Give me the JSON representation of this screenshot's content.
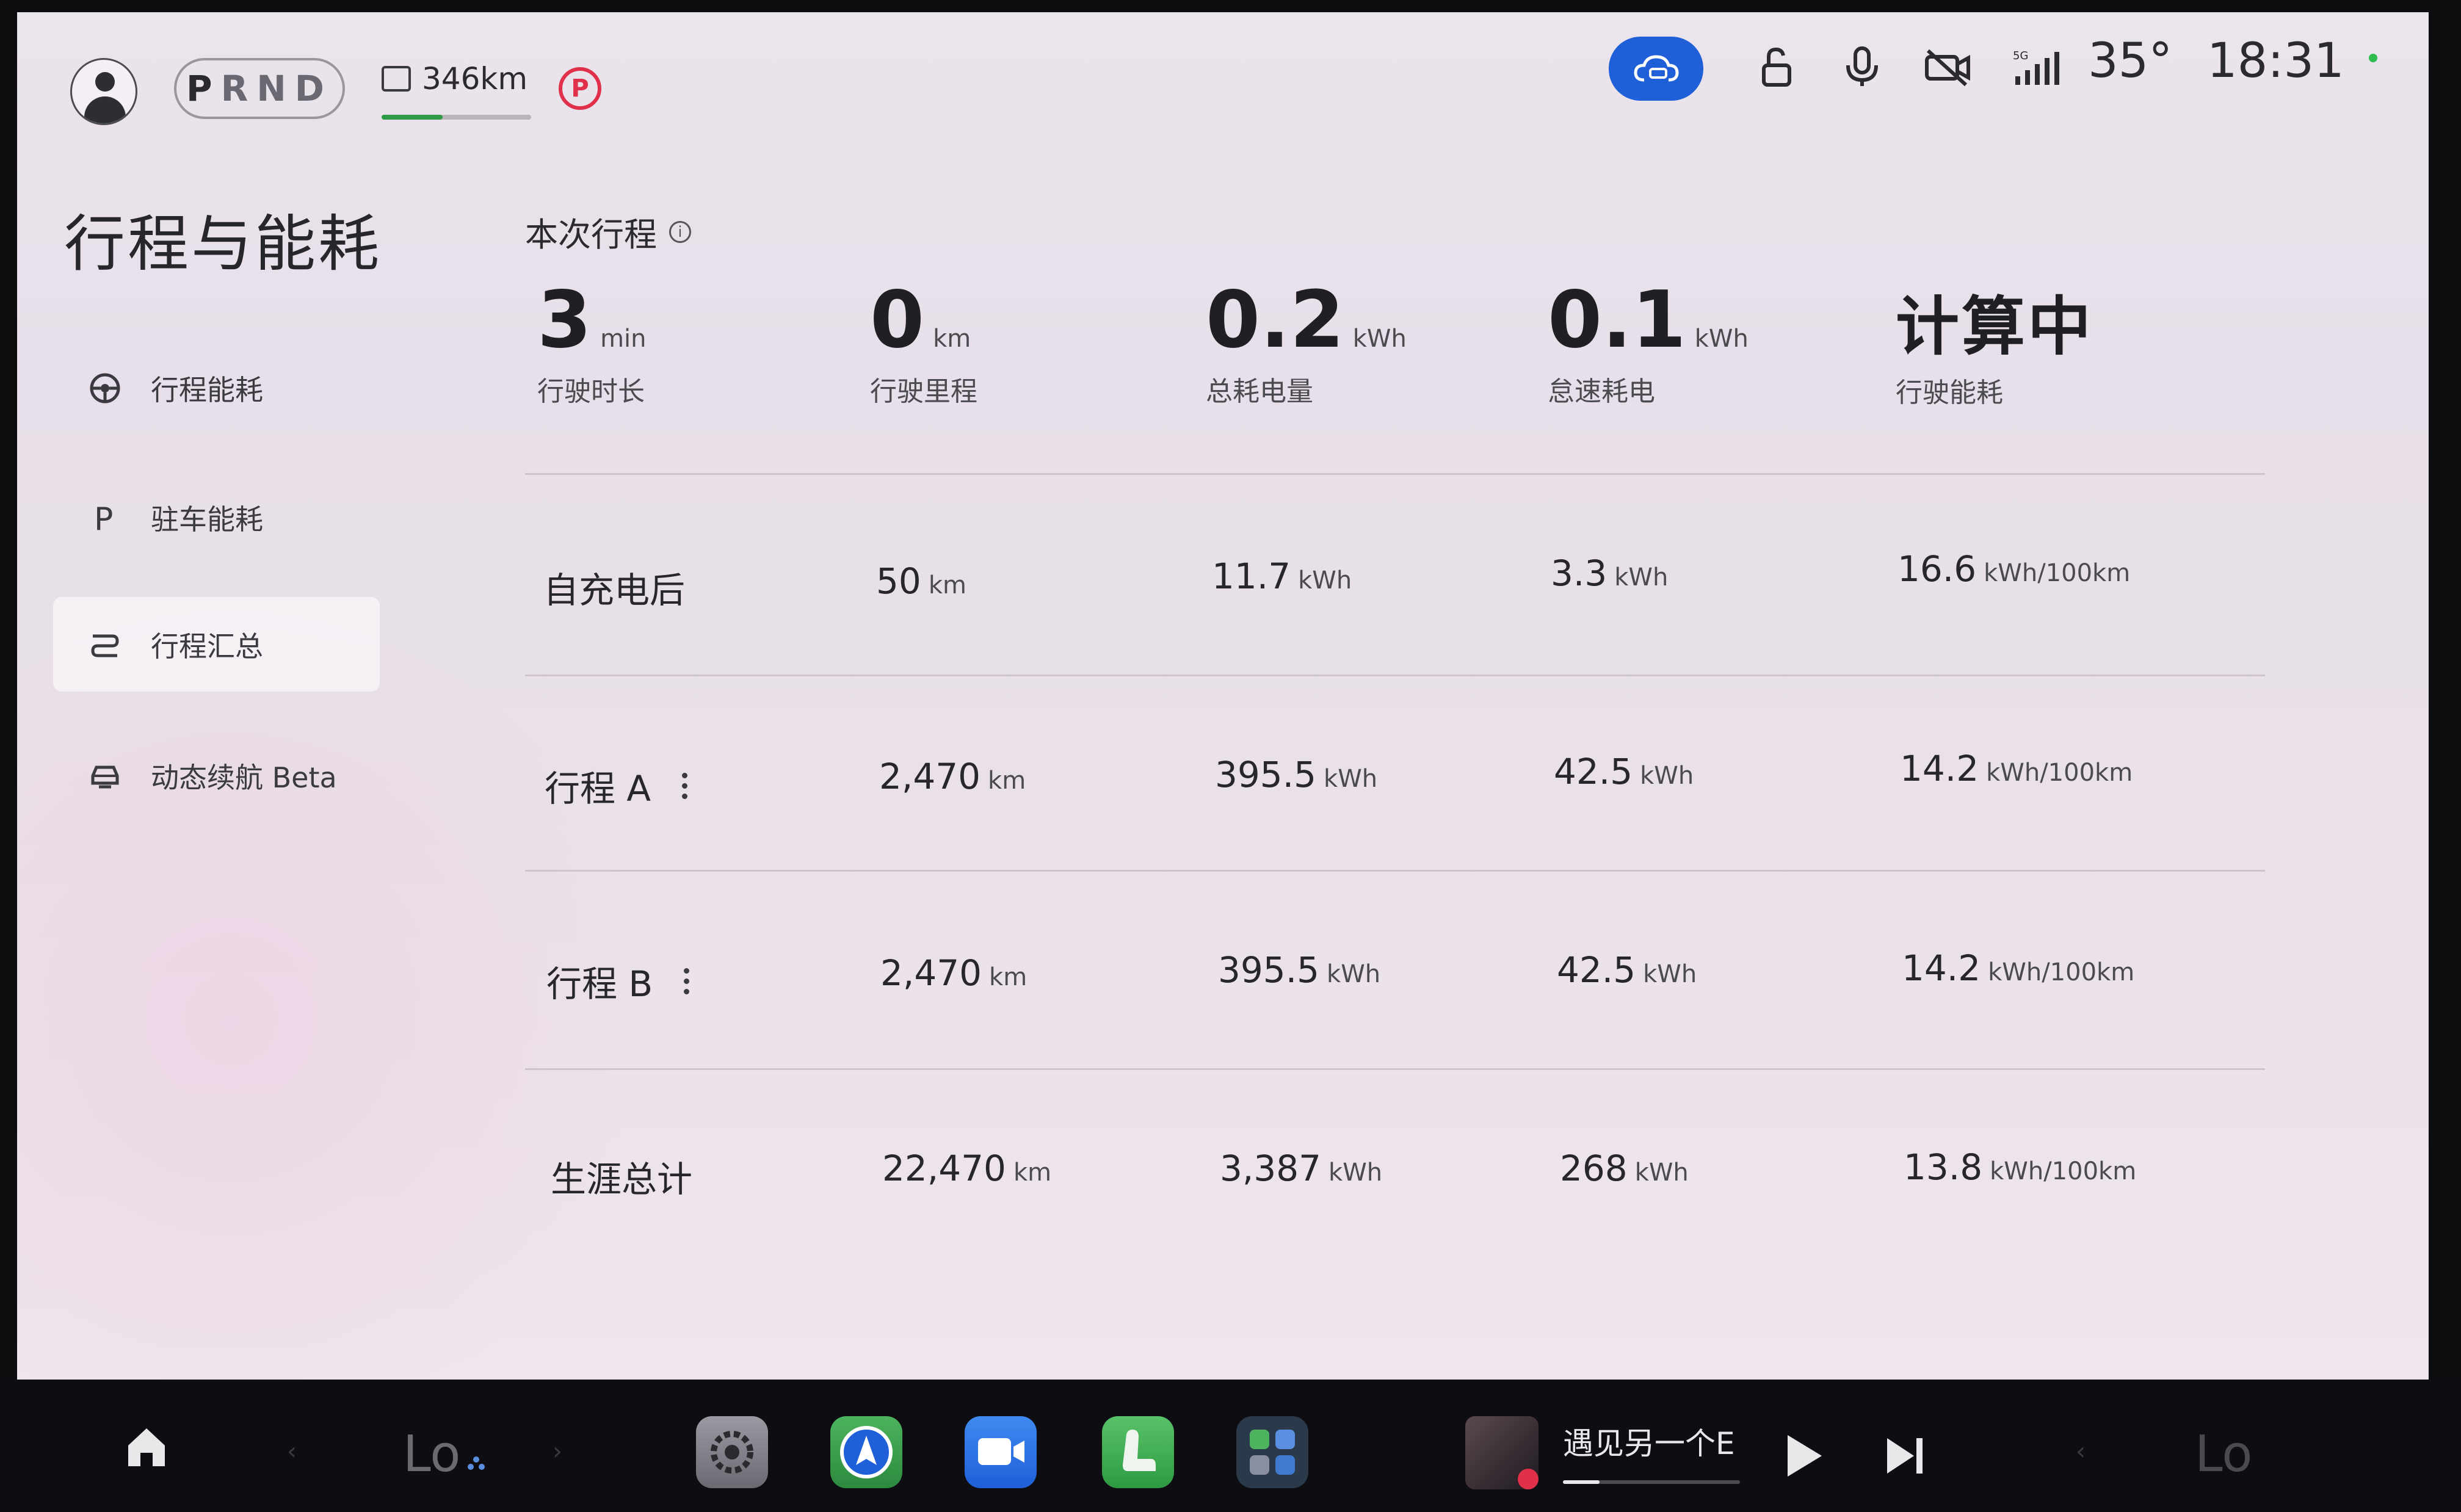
{
  "status_bar": {
    "gears": [
      "P",
      "R",
      "N",
      "D"
    ],
    "range": "346km",
    "park_symbol": "P",
    "temperature": "35°",
    "time": "18:31",
    "network": "5G"
  },
  "sidebar": {
    "title": "行程与能耗",
    "items": [
      {
        "label": "行程能耗",
        "icon": "steering-wheel-icon"
      },
      {
        "label": "驻车能耗",
        "icon": "parking-letter-icon"
      },
      {
        "label": "行程汇总",
        "icon": "route-icon"
      },
      {
        "label": "动态续航 Beta",
        "icon": "car-range-icon"
      }
    ]
  },
  "current_trip": {
    "title": "本次行程",
    "stats": [
      {
        "value": "3",
        "unit": "min",
        "label": "行驶时长"
      },
      {
        "value": "0",
        "unit": "km",
        "label": "行驶里程"
      },
      {
        "value": "0.2",
        "unit": "kWh",
        "label": "总耗电量"
      },
      {
        "value": "0.1",
        "unit": "kWh",
        "label": "怠速耗电"
      },
      {
        "value": "计算中",
        "unit": "",
        "label": "行驶能耗"
      }
    ]
  },
  "summary_rows": [
    {
      "label": "自充电后",
      "distance": "50",
      "distance_unit": "km",
      "total": "11.7",
      "total_unit": "kWh",
      "idle": "3.3",
      "idle_unit": "kWh",
      "consumption": "16.6",
      "consumption_unit": "kWh/100km",
      "menu": false
    },
    {
      "label": "行程 A",
      "distance": "2,470",
      "distance_unit": "km",
      "total": "395.5",
      "total_unit": "kWh",
      "idle": "42.5",
      "idle_unit": "kWh",
      "consumption": "14.2",
      "consumption_unit": "kWh/100km",
      "menu": true
    },
    {
      "label": "行程 B",
      "distance": "2,470",
      "distance_unit": "km",
      "total": "395.5",
      "total_unit": "kWh",
      "idle": "42.5",
      "idle_unit": "kWh",
      "consumption": "14.2",
      "consumption_unit": "kWh/100km",
      "menu": true
    },
    {
      "label": "生涯总计",
      "distance": "22,470",
      "distance_unit": "km",
      "total": "3,387",
      "total_unit": "kWh",
      "idle": "268",
      "idle_unit": "kWh",
      "consumption": "13.8",
      "consumption_unit": "kWh/100km",
      "menu": false
    }
  ],
  "dock": {
    "left_climate": "Lo",
    "right_climate": "Lo",
    "media_title": "遇见另一个E",
    "media_progress": 0.2
  },
  "colors": {
    "accent_blue": "#1f5fd8",
    "park_red": "#e0304a",
    "range_green": "#2e9b4a"
  }
}
